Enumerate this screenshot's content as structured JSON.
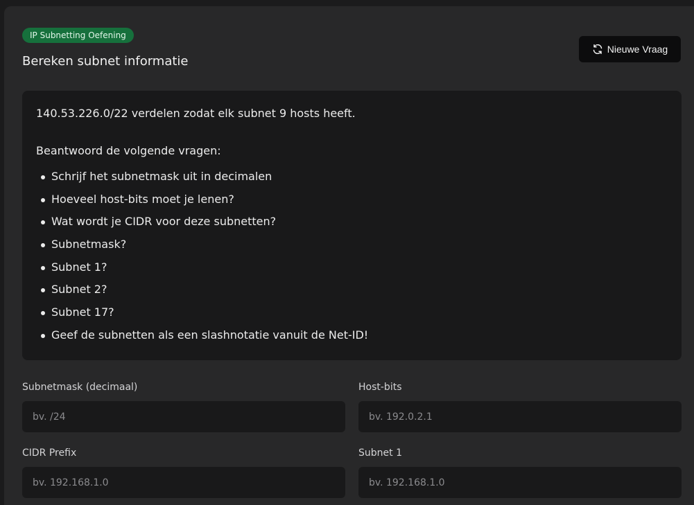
{
  "header": {
    "badge": "IP Subnetting Oefening",
    "title": "Bereken subnet informatie",
    "new_question_label": "Nieuwe Vraag",
    "new_question_icon": "refresh-icon"
  },
  "question": {
    "text": "140.53.226.0/22 verdelen zodat elk subnet 9 hosts heeft.",
    "instruction": "Beantwoord de volgende vragen:",
    "items": [
      "Schrijf het subnetmask uit in decimalen",
      "Hoeveel host-bits moet je lenen?",
      "Wat wordt je CIDR voor deze subnetten?",
      "Subnetmask?",
      "Subnet 1?",
      "Subnet 2?",
      "Subnet 17?",
      "Geef de subnetten als een slashnotatie vanuit de Net-ID!"
    ]
  },
  "form": {
    "fields": [
      {
        "label": "Subnetmask (decimaal)",
        "placeholder": "bv. /24",
        "value": ""
      },
      {
        "label": "Host-bits",
        "placeholder": "bv. 192.0.2.1",
        "value": ""
      },
      {
        "label": "CIDR Prefix",
        "placeholder": "bv. 192.168.1.0",
        "value": ""
      },
      {
        "label": "Subnet 1",
        "placeholder": "bv. 192.168.1.0",
        "value": ""
      }
    ]
  },
  "colors": {
    "page_background": "#1b1b1c",
    "card_background": "#282829",
    "panel_background": "#19191a",
    "badge_green": "#16703c",
    "button_background": "#0c0c0d"
  }
}
